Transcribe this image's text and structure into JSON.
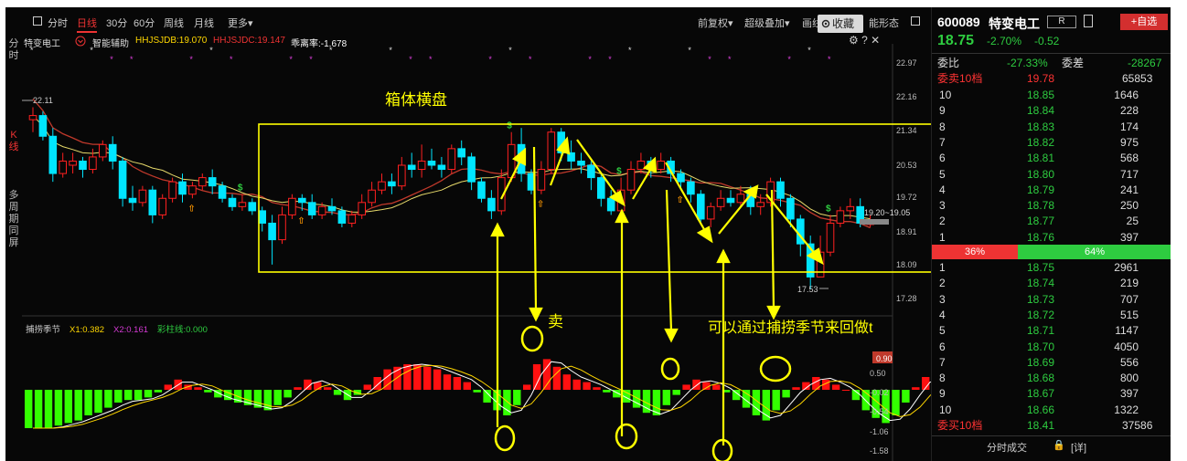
{
  "nav": {
    "left": [
      "分时",
      "K线",
      "多周期同屏"
    ],
    "toolbar": {
      "tabs": [
        "分时",
        "日线",
        "30分",
        "60分",
        "周线",
        "月线",
        "更多▾"
      ],
      "right_items": [
        "前复权▾",
        "超级叠加▾",
        "画线"
      ],
      "cut_text": "能形态",
      "collect_label": "收藏"
    }
  },
  "indicator_header": {
    "name": "特变电工",
    "assist": "智能辅助",
    "hhjsjdb": "HHJSJDB:19.070",
    "hhjsjdc": "HHJSJDC:19.147",
    "rate": "乖离率:-1.678"
  },
  "price_axis": [
    "22.97",
    "22.16",
    "21.34",
    "20.53",
    "19.72",
    "18.91",
    "18.09",
    "17.28"
  ],
  "price_labels": {
    "high": "22.11",
    "low": "17.53",
    "last": "19.20~19.05"
  },
  "annotations": {
    "box_label": "箱体横盘",
    "sell_label": "卖",
    "note": "可以通过捕捞季节来回做t"
  },
  "sub_indicator": {
    "name": "捕捞季节",
    "x1": "X1:0.382",
    "x2": "X2:0.161",
    "bars": "彩柱线:0.000",
    "axis": [
      "0.90",
      "0.50",
      "-0.02",
      "-0.54",
      "-1.06",
      "-1.58"
    ]
  },
  "chart_data": {
    "type": "candlestick",
    "candles": [
      [
        21.6,
        21.7,
        21.3,
        21.9
      ],
      [
        21.7,
        21.2,
        21.1,
        21.8
      ],
      [
        21.2,
        20.3,
        20.1,
        21.4
      ],
      [
        20.3,
        20.6,
        20.2,
        20.8
      ],
      [
        20.5,
        20.6,
        20.3,
        20.8
      ],
      [
        20.6,
        20.4,
        20.2,
        20.7
      ],
      [
        20.4,
        20.7,
        20.3,
        20.9
      ],
      [
        20.7,
        21.0,
        20.6,
        21.1
      ],
      [
        21.0,
        20.6,
        20.4,
        21.2
      ],
      [
        20.6,
        19.7,
        19.5,
        20.7
      ],
      [
        19.7,
        19.6,
        19.4,
        20.0
      ],
      [
        19.6,
        19.9,
        19.5,
        20.0
      ],
      [
        19.9,
        19.3,
        19.1,
        20.0
      ],
      [
        19.3,
        19.7,
        19.2,
        19.8
      ],
      [
        19.7,
        20.1,
        19.6,
        20.2
      ],
      [
        20.1,
        19.8,
        19.6,
        20.3
      ],
      [
        19.8,
        20.0,
        19.7,
        20.1
      ],
      [
        20.0,
        20.2,
        19.9,
        20.3
      ],
      [
        20.2,
        20.0,
        19.8,
        20.4
      ],
      [
        20.0,
        19.7,
        19.6,
        20.1
      ],
      [
        19.7,
        19.5,
        19.4,
        19.8
      ],
      [
        19.5,
        19.6,
        19.4,
        19.8
      ],
      [
        19.6,
        19.4,
        19.3,
        19.7
      ],
      [
        19.4,
        19.1,
        18.9,
        19.5
      ],
      [
        19.1,
        18.7,
        18.1,
        19.3
      ],
      [
        18.7,
        19.3,
        18.6,
        19.5
      ],
      [
        19.3,
        19.7,
        19.2,
        19.8
      ],
      [
        19.7,
        19.6,
        19.4,
        19.8
      ],
      [
        19.6,
        19.3,
        19.2,
        19.8
      ],
      [
        19.3,
        19.5,
        19.2,
        19.6
      ],
      [
        19.5,
        19.4,
        19.3,
        19.7
      ],
      [
        19.4,
        19.1,
        19.0,
        19.5
      ],
      [
        19.1,
        19.3,
        19.0,
        19.4
      ],
      [
        19.3,
        19.6,
        19.2,
        19.8
      ],
      [
        19.6,
        19.9,
        19.5,
        20.1
      ],
      [
        19.9,
        20.1,
        19.8,
        20.3
      ],
      [
        20.1,
        20.0,
        19.8,
        20.3
      ],
      [
        20.0,
        20.5,
        19.9,
        20.7
      ],
      [
        20.5,
        20.4,
        20.2,
        20.8
      ],
      [
        20.4,
        20.6,
        20.2,
        21.0
      ],
      [
        20.6,
        20.5,
        20.4,
        20.9
      ],
      [
        20.5,
        20.4,
        20.2,
        20.7
      ],
      [
        20.4,
        20.9,
        20.3,
        21.0
      ],
      [
        20.9,
        20.7,
        20.5,
        21.1
      ],
      [
        20.7,
        20.1,
        19.9,
        20.8
      ],
      [
        20.1,
        19.7,
        19.6,
        20.2
      ],
      [
        19.7,
        19.4,
        19.2,
        19.9
      ],
      [
        19.4,
        20.2,
        19.3,
        20.4
      ],
      [
        20.2,
        21.0,
        20.1,
        21.3
      ],
      [
        21.0,
        20.3,
        20.1,
        21.4
      ],
      [
        20.3,
        19.9,
        19.8,
        20.4
      ],
      [
        19.9,
        20.4,
        19.8,
        20.6
      ],
      [
        20.4,
        21.3,
        20.3,
        21.4
      ],
      [
        21.3,
        20.8,
        20.6,
        21.4
      ],
      [
        20.8,
        20.6,
        20.4,
        21.1
      ],
      [
        20.6,
        20.5,
        20.3,
        20.8
      ],
      [
        20.5,
        20.2,
        19.9,
        20.6
      ],
      [
        20.2,
        19.7,
        19.5,
        20.3
      ],
      [
        19.7,
        19.4,
        19.3,
        19.9
      ],
      [
        19.4,
        19.9,
        19.3,
        20.2
      ],
      [
        19.9,
        20.4,
        19.8,
        20.6
      ],
      [
        20.4,
        20.6,
        20.3,
        20.8
      ],
      [
        20.6,
        20.4,
        20.2,
        20.7
      ],
      [
        20.4,
        20.6,
        20.3,
        20.8
      ],
      [
        20.6,
        20.3,
        20.1,
        20.7
      ],
      [
        20.3,
        20.1,
        19.9,
        20.4
      ],
      [
        20.1,
        19.8,
        19.6,
        20.2
      ],
      [
        19.8,
        19.2,
        19.1,
        19.9
      ],
      [
        19.2,
        19.5,
        19.0,
        19.6
      ],
      [
        19.5,
        19.7,
        19.4,
        19.9
      ],
      [
        19.7,
        19.6,
        19.5,
        19.9
      ],
      [
        19.6,
        19.8,
        19.5,
        20.0
      ],
      [
        19.8,
        19.5,
        19.3,
        20.0
      ],
      [
        19.5,
        19.6,
        19.3,
        19.8
      ],
      [
        19.6,
        20.1,
        19.5,
        20.2
      ],
      [
        20.1,
        19.7,
        19.5,
        20.2
      ],
      [
        19.7,
        19.2,
        19.0,
        19.8
      ],
      [
        19.2,
        18.6,
        18.3,
        19.3
      ],
      [
        18.6,
        17.8,
        17.5,
        18.8
      ],
      [
        17.8,
        18.4,
        17.8,
        18.8
      ],
      [
        18.4,
        19.1,
        18.3,
        19.3
      ],
      [
        19.1,
        19.4,
        19.0,
        19.5
      ],
      [
        19.4,
        19.5,
        19.2,
        19.7
      ],
      [
        19.5,
        19.1,
        19.0,
        19.7
      ],
      [
        19.1,
        19.1,
        19.0,
        19.3
      ]
    ],
    "macd": [
      -1.5,
      -1.5,
      -1.5,
      -1.4,
      -1.3,
      -1.2,
      -1.0,
      -0.9,
      -0.7,
      -0.5,
      -0.4,
      -0.4,
      -0.3,
      -0.1,
      0.2,
      0.4,
      0.2,
      0.1,
      -0.1,
      -0.3,
      -0.4,
      -0.5,
      -0.6,
      -0.7,
      -0.8,
      -0.6,
      -0.3,
      0.1,
      0.4,
      0.3,
      0.1,
      -0.2,
      -0.4,
      -0.2,
      0.2,
      0.5,
      0.8,
      0.9,
      1.0,
      1.0,
      0.9,
      0.8,
      0.6,
      0.5,
      0.3,
      -0.1,
      -0.5,
      -0.8,
      -1.0,
      -0.6,
      0.2,
      1.0,
      1.2,
      0.9,
      0.6,
      0.4,
      0.3,
      0.1,
      -0.1,
      -0.3,
      -0.5,
      -0.7,
      -0.9,
      -1.0,
      -0.6,
      -0.2,
      0.2,
      0.4,
      0.3,
      0.2,
      -0.1,
      -0.4,
      -0.7,
      -1.0,
      -1.2,
      -0.8,
      -0.3,
      0.1,
      0.3,
      0.5,
      0.4,
      0.2,
      0.0,
      -0.4,
      -0.8,
      -1.1,
      -1.3,
      -1.0,
      -0.5,
      0.1,
      0.5,
      0.3
    ]
  },
  "stock": {
    "code": "600089",
    "name": "特变电工",
    "price": "18.75",
    "change_pct": "-2.70%",
    "change": "-0.52",
    "r_btn": "R",
    "add_fav": "+自选",
    "weibi_label": "委比",
    "weibi": "-27.33%",
    "weicha_label": "委差",
    "weicha": "-28267",
    "sell10_label": "委卖10档",
    "sell10_price": "19.78",
    "sell10_vol": "65853",
    "buy10_label": "委买10档",
    "buy10_price": "18.41",
    "buy10_vol": "37586",
    "ratio_left": "36%",
    "ratio_right": "64%",
    "sell_rows": [
      [
        "10",
        "18.85",
        "1646"
      ],
      [
        "9",
        "18.84",
        "228"
      ],
      [
        "8",
        "18.83",
        "174"
      ],
      [
        "7",
        "18.82",
        "975"
      ],
      [
        "6",
        "18.81",
        "568"
      ],
      [
        "5",
        "18.80",
        "717"
      ],
      [
        "4",
        "18.79",
        "241"
      ],
      [
        "3",
        "18.78",
        "250"
      ],
      [
        "2",
        "18.77",
        "25"
      ],
      [
        "1",
        "18.76",
        "397"
      ]
    ],
    "buy_rows": [
      [
        "1",
        "18.75",
        "2961"
      ],
      [
        "2",
        "18.74",
        "219"
      ],
      [
        "3",
        "18.73",
        "707"
      ],
      [
        "4",
        "18.72",
        "515"
      ],
      [
        "5",
        "18.71",
        "1147"
      ],
      [
        "6",
        "18.70",
        "4050"
      ],
      [
        "7",
        "18.69",
        "556"
      ],
      [
        "8",
        "18.68",
        "800"
      ],
      [
        "9",
        "18.67",
        "397"
      ],
      [
        "10",
        "18.66",
        "1322"
      ]
    ],
    "bottom_tab": "分时成交",
    "bottom_tab2": "[详]"
  },
  "colors": {
    "up": "#ff2020",
    "down": "#00e5ff",
    "macd_up": "#ff1010",
    "macd_down": "#33ff00",
    "highlight": "#ffff00"
  }
}
